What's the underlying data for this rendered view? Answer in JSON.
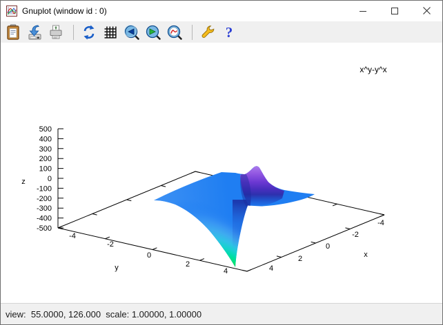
{
  "window": {
    "title": "Gnuplot (window id : 0)",
    "status_text": "view:  55.0000, 126.000  scale: 1.00000, 1.00000"
  },
  "toolbar": {
    "help_glyph": "?",
    "icons": [
      "copy-to-clipboard",
      "save-image",
      "print",
      "replot",
      "toggle-grid",
      "zoom-previous",
      "zoom-next",
      "autoscale-restore",
      "options-wrench",
      "help"
    ]
  },
  "plot": {
    "function_label": "x^y-y^x",
    "axis_labels": {
      "x": "x",
      "y": "y",
      "z": "z"
    },
    "x_ticks": [
      "4",
      "2",
      "0",
      "-2",
      "-4"
    ],
    "y_ticks": [
      "-4",
      "-2",
      "0",
      "2",
      "4"
    ],
    "z_ticks": [
      "500",
      "400",
      "300",
      "200",
      "100",
      "0",
      "-100",
      "-200",
      "-300",
      "-400",
      "-500"
    ],
    "colors": {
      "surface_blue": "#1f7ef2",
      "dip_green": "#16de5c",
      "dip_teal": "#16d2ce",
      "peak_purple": "#b285ee",
      "peak_indigo": "#4a2ebe",
      "shadow_navy": "#1b2ea4"
    }
  },
  "chart_data": {
    "type": "surface3d",
    "title": "x^y-y^x",
    "xlabel": "x",
    "ylabel": "y",
    "zlabel": "z",
    "xlim": [
      -4,
      4
    ],
    "ylim": [
      -4,
      4
    ],
    "zlim": [
      -500,
      500
    ],
    "x_ticks": [
      4,
      2,
      0,
      -2,
      -4
    ],
    "y_ticks": [
      -4,
      -2,
      0,
      2,
      4
    ],
    "z_ticks": [
      500,
      400,
      300,
      200,
      100,
      0,
      -100,
      -200,
      -300,
      -400,
      -500
    ],
    "surface": "z = x^y - y^x plotted over x,y in [-4,4]; surface is flat near z=0 over most of the visible quadrant, with a sharp positive peak (purple) and a deep negative funnel (green/cyan) near the front edge",
    "view": [
      55.0,
      126.0
    ],
    "scale": [
      1.0,
      1.0
    ]
  }
}
